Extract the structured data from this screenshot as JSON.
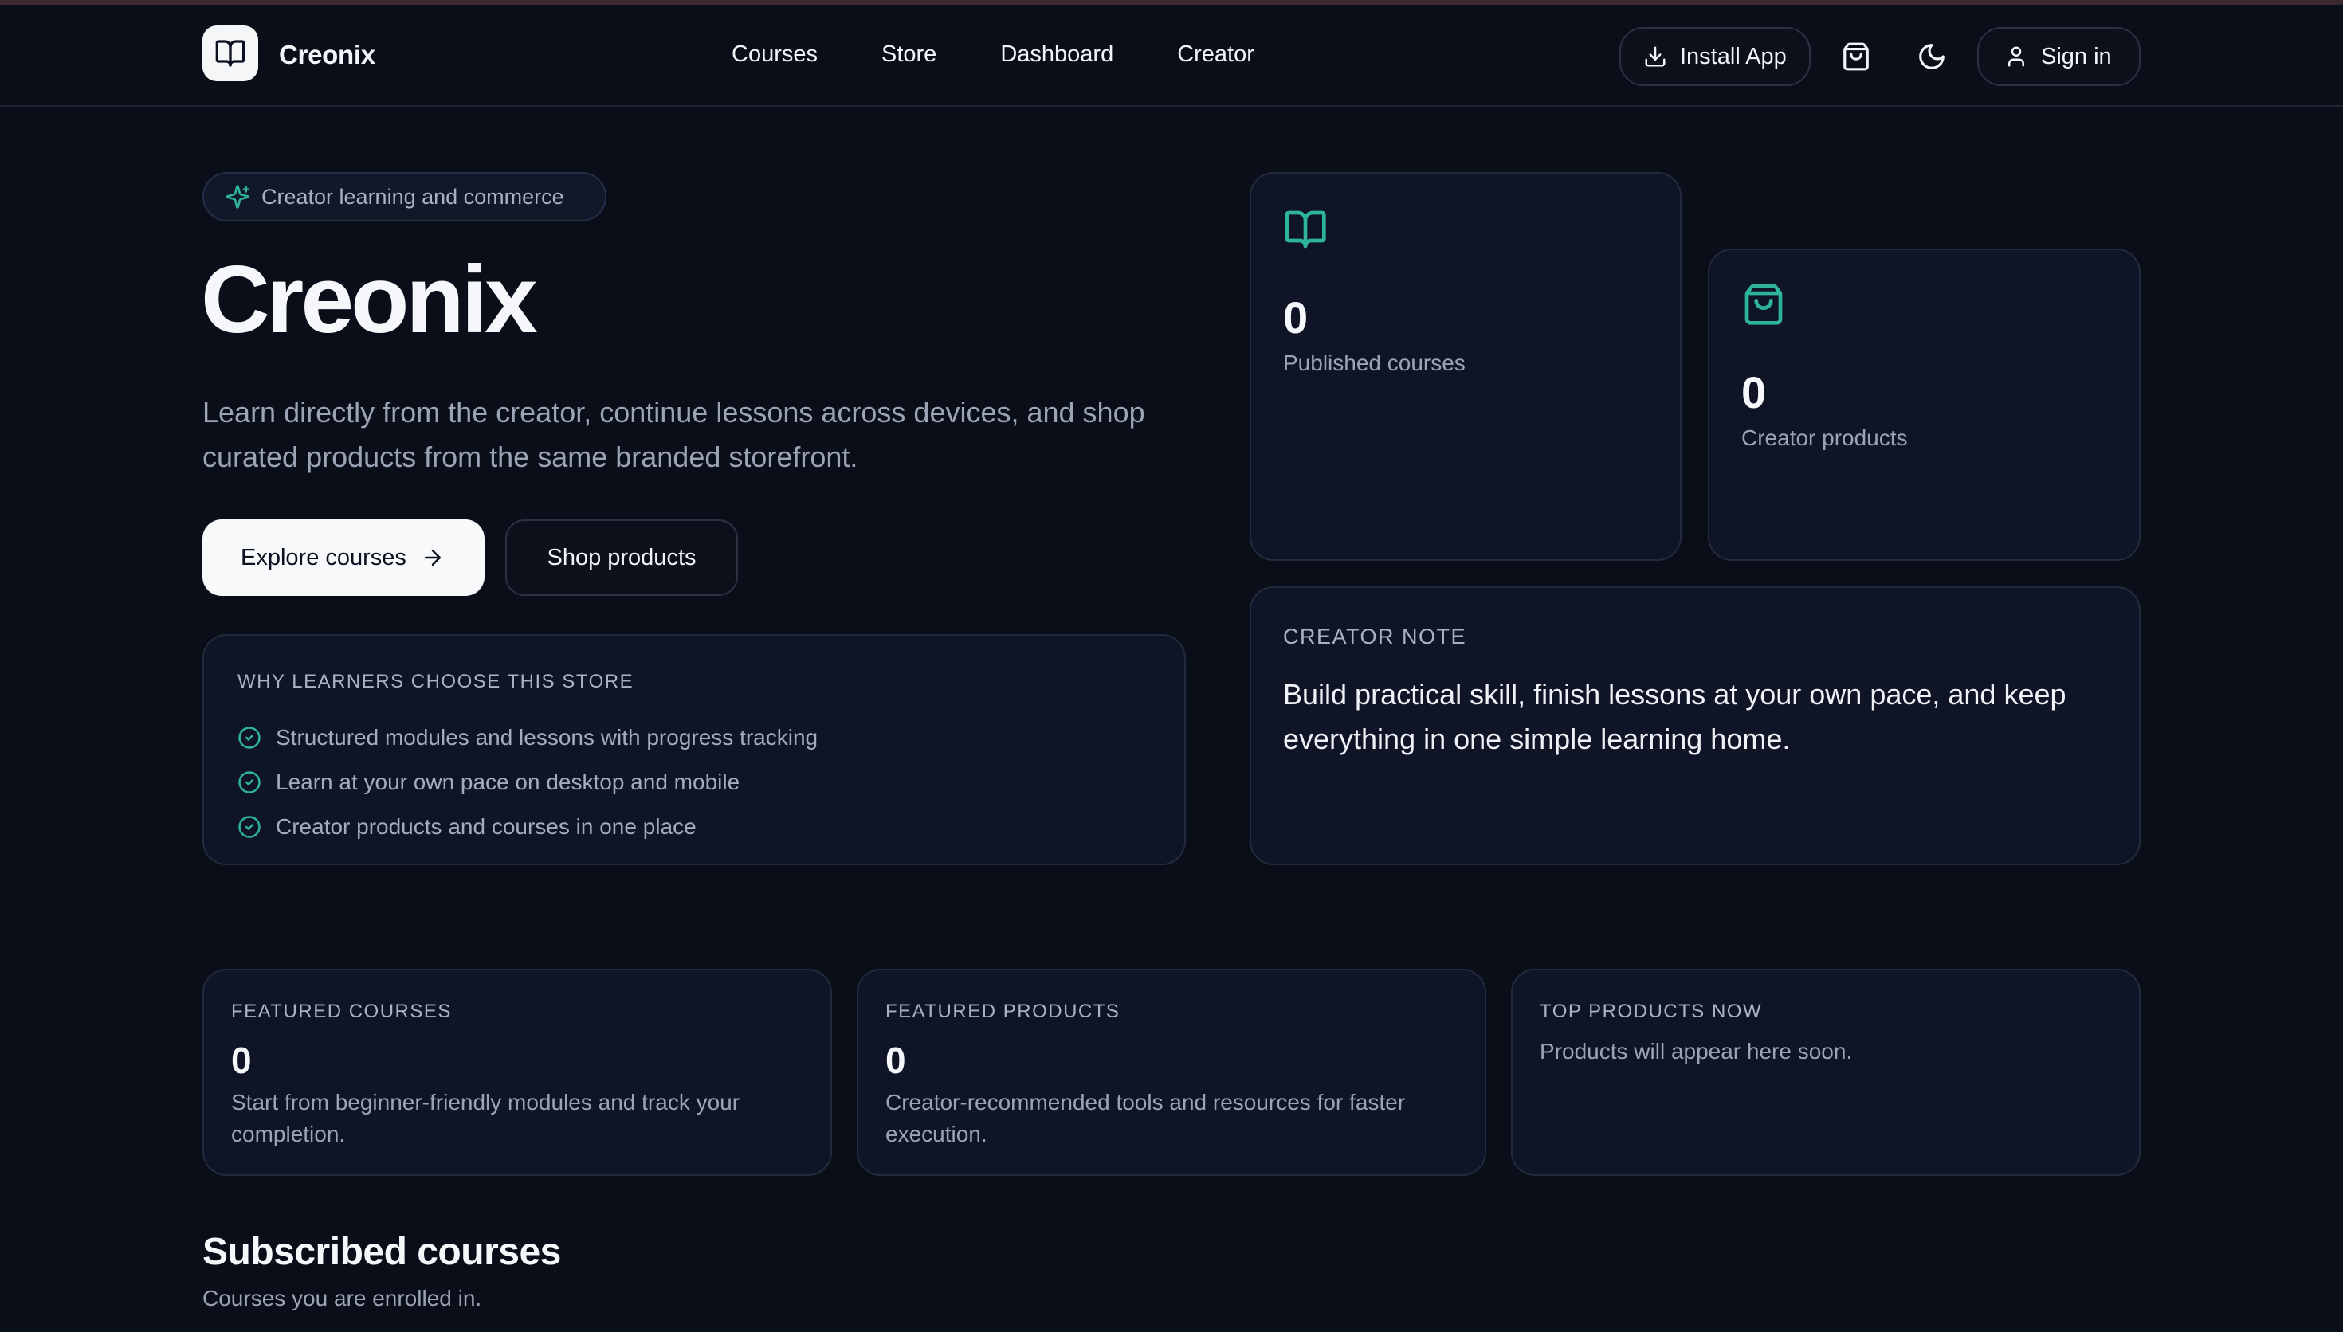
{
  "brand": {
    "name": "Creonix"
  },
  "nav": {
    "items": [
      "Courses",
      "Store",
      "Dashboard",
      "Creator"
    ]
  },
  "header": {
    "install_label": "Install App",
    "signin_label": "Sign in"
  },
  "hero": {
    "badge": "Creator learning and commerce",
    "title": "Creonix",
    "lead": "Learn directly from the creator, continue lessons across devices, and shop curated products from the same branded storefront.",
    "primary_cta": "Explore courses",
    "secondary_cta": "Shop products"
  },
  "why": {
    "title": "WHY LEARNERS CHOOSE THIS STORE",
    "items": [
      "Structured modules and lessons with progress tracking",
      "Learn at your own pace on desktop and mobile",
      "Creator products and courses in one place"
    ]
  },
  "stats": {
    "courses": {
      "value": "0",
      "label": "Published courses"
    },
    "products": {
      "value": "0",
      "label": "Creator products"
    }
  },
  "note": {
    "title": "CREATOR NOTE",
    "text": "Build practical skill, finish lessons at your own pace, and keep everything in one simple learning home."
  },
  "featured": {
    "courses": {
      "title": "FEATURED COURSES",
      "value": "0",
      "desc": "Start from beginner-friendly modules and track your completion."
    },
    "products": {
      "title": "FEATURED PRODUCTS",
      "value": "0",
      "desc": "Creator-recommended tools and resources for faster execution."
    },
    "top": {
      "title": "TOP PRODUCTS NOW",
      "desc": "Products will appear here soon."
    }
  },
  "subscribed": {
    "title": "Subscribed courses",
    "subtitle": "Courses you are enrolled in."
  },
  "colors": {
    "accent": "#2fb39a",
    "background": "#0a0e18",
    "card": "#0f1526"
  },
  "icons": [
    "book-icon",
    "download-icon",
    "shopping-bag-icon",
    "moon-icon",
    "user-icon",
    "sparkle-icon",
    "arrow-right-icon",
    "check-circle-icon"
  ]
}
